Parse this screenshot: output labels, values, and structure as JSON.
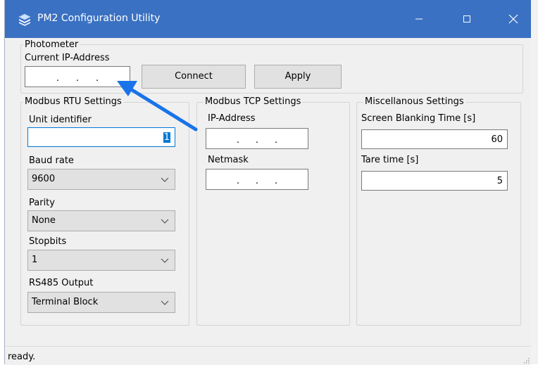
{
  "window": {
    "title": "PM2 Configuration Utility"
  },
  "photometer": {
    "legend": "Photometer",
    "ip_label": "Current IP-Address",
    "ip_value": ". . .",
    "connect_label": "Connect",
    "apply_label": "Apply"
  },
  "modbus_rtu": {
    "legend": "Modbus RTU Settings",
    "unit_identifier_label": "Unit identifier",
    "unit_identifier_value": "1",
    "baud_rate_label": "Baud rate",
    "baud_rate_value": "9600",
    "parity_label": "Parity",
    "parity_value": "None",
    "stopbits_label": "Stopbits",
    "stopbits_value": "1",
    "rs485_label": "RS485 Output",
    "rs485_value": "Terminal Block"
  },
  "modbus_tcp": {
    "legend": "Modbus TCP Settings",
    "ip_label": "IP-Address",
    "netmask_label": "Netmask"
  },
  "misc": {
    "legend": "Miscellanous Settings",
    "screen_blanking_label": "Screen Blanking Time [s]",
    "screen_blanking_value": "60",
    "tare_time_label": "Tare time [s]",
    "tare_time_value": "5"
  },
  "status": {
    "text": "ready."
  },
  "colors": {
    "titlebar": "#3a71c2",
    "annotation_arrow": "#1a73e8",
    "selection": "#0078d7"
  },
  "icons": [
    "app-icon",
    "minimize-icon",
    "maximize-icon",
    "close-icon",
    "chevron-down-icon",
    "size-grip-icon"
  ]
}
